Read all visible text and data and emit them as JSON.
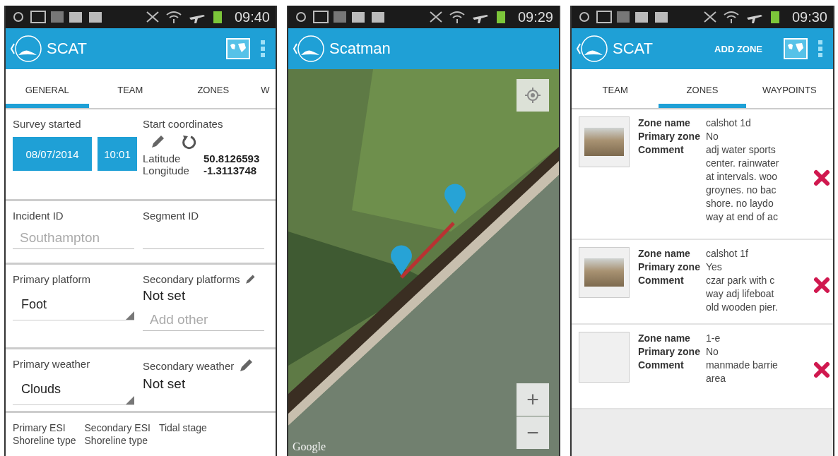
{
  "form_screen": {
    "time": "09:40",
    "title": "SCAT",
    "tabs": [
      {
        "label": "GENERAL",
        "selected": true
      },
      {
        "label": "TEAM",
        "selected": false
      },
      {
        "label": "ZONES",
        "selected": false
      },
      {
        "label": "W",
        "selected": false
      }
    ],
    "survey_started": {
      "label": "Survey started",
      "date": "08/07/2014",
      "time": "10:01"
    },
    "start_coordinates": {
      "label": "Start coordinates",
      "latitude_label": "Latitude",
      "latitude": "50.8126593",
      "longitude_label": "Longitude",
      "longitude": "-1.3113748"
    },
    "incident_id": {
      "label": "Incident ID",
      "placeholder": "Southampton"
    },
    "segment_id": {
      "label": "Segment ID"
    },
    "primary_platform": {
      "label": "Primary platform",
      "value": "Foot"
    },
    "secondary_platforms": {
      "label": "Secondary platforms",
      "value": "Not set",
      "placeholder": "Add other"
    },
    "primary_weather": {
      "label": "Primary weather",
      "value": "Clouds"
    },
    "secondary_weather": {
      "label": "Secondary weather",
      "value": "Not set"
    },
    "footer_columns": [
      {
        "lines": [
          "Primary ESI",
          "Shoreline type"
        ]
      },
      {
        "lines": [
          "Secondary ESI",
          "Shoreline type"
        ]
      },
      {
        "lines": [
          "Tidal stage"
        ]
      }
    ]
  },
  "map_screen": {
    "time": "09:29",
    "title": "Scatman",
    "zoom_in": "+",
    "zoom_out": "−",
    "attribution": "Google"
  },
  "zones_screen": {
    "time": "09:30",
    "title": "SCAT",
    "action": "ADD ZONE",
    "tabs": [
      {
        "label": "TEAM",
        "selected": false
      },
      {
        "label": "ZONES",
        "selected": true
      },
      {
        "label": "WAYPOINTS",
        "selected": false
      }
    ],
    "zones": [
      {
        "photo": true,
        "name_label": "Zone name",
        "name": "calshot 1d",
        "primary_label": "Primary zone",
        "primary": "No",
        "comment_label": "Comment",
        "comment_lines": [
          "adj water sports",
          "center. rainwater",
          "at intervals. woo",
          "groynes. no bac",
          "shore.  no laydo",
          "way at end of ac"
        ]
      },
      {
        "photo": true,
        "name_label": "Zone name",
        "name": "calshot 1f",
        "primary_label": "Primary zone",
        "primary": "Yes",
        "comment_label": "Comment",
        "comment_lines": [
          "czar park with c",
          "way adj lifeboat",
          "old wooden pier."
        ]
      },
      {
        "photo": false,
        "name_label": "Zone name",
        "name": "1-e",
        "primary_label": "Primary zone",
        "primary": "No",
        "comment_label": "Comment",
        "comment_lines": [
          "manmade barrie",
          "area"
        ]
      }
    ]
  }
}
